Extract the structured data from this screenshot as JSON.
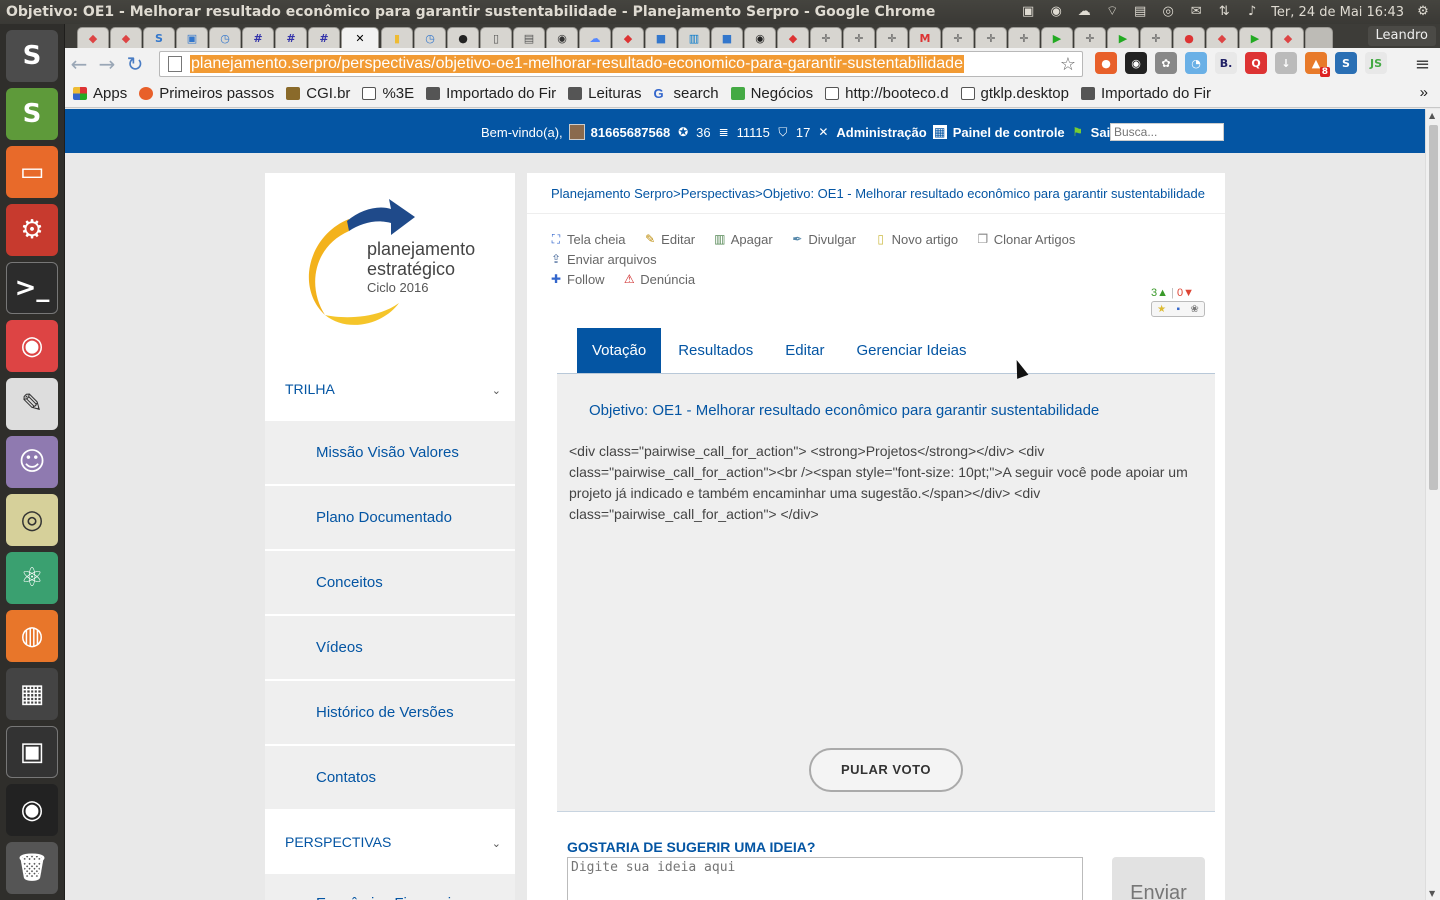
{
  "window": {
    "title": "Objetivo: OE1 - Melhorar resultado econômico para garantir sustentabilidade - Planejamento Serpro - Google Chrome",
    "clock": "Ter, 24 de Mai 16:43"
  },
  "chrome": {
    "profile": "Leandro",
    "url": "planejamento.serpro/perspectivas/objetivo-oe1-melhorar-resultado-economico-para-garantir-sustentabilidade",
    "bookmarks": [
      {
        "label": "Apps",
        "icon": "apps-grid-icon"
      },
      {
        "label": "Primeiros passos",
        "icon": "firefox-icon"
      },
      {
        "label": "CGI.br",
        "icon": "cgi-icon"
      },
      {
        "label": "%3E",
        "icon": "page-icon"
      },
      {
        "label": "Importado do Fir",
        "icon": "folder-icon"
      },
      {
        "label": "Leituras",
        "icon": "folder-icon"
      },
      {
        "label": "search",
        "icon": "google-icon"
      },
      {
        "label": "Negócios",
        "icon": "upwork-icon"
      },
      {
        "label": "http://booteco.d",
        "icon": "page-icon"
      },
      {
        "label": "gtklp.desktop",
        "icon": "page-icon"
      },
      {
        "label": "Importado do Fir",
        "icon": "folder-icon"
      }
    ],
    "bookmarks_more": "»",
    "extension_badge": "8"
  },
  "site": {
    "welcome": "Bem-vindo(a),",
    "user": "81665687568",
    "points": "36",
    "coins": "11115",
    "badges": "17",
    "admin": "Administração",
    "panel": "Painel de controle",
    "logout": "Sair",
    "search_placeholder": "Busca..."
  },
  "logo": {
    "line1": "planejamento",
    "line2": "estratégico",
    "line3": "Ciclo 2016"
  },
  "sidebar": {
    "head1": "TRILHA",
    "items": [
      "Missão Visão Valores",
      "Plano Documentado",
      "Conceitos",
      "Vídeos",
      "Histórico de Versões",
      "Contatos"
    ],
    "head2": "PERSPECTIVAS",
    "sub1": "Econômico Financeira"
  },
  "breadcrumb": {
    "root": "Planejamento Serpro",
    "sep": ">",
    "level1": "Perspectivas",
    "current": "Objetivo: OE1 - Melhorar resultado econômico para garantir sustentabilidade"
  },
  "actions": {
    "fullscreen": "Tela cheia",
    "edit": "Editar",
    "delete": "Apagar",
    "spread": "Divulgar",
    "new_article": "Novo artigo",
    "clone": "Clonar Artigos",
    "upload": "Enviar arquivos",
    "follow": "Follow",
    "report": "Denúncia"
  },
  "votes": {
    "up": "3",
    "down": "0"
  },
  "tabs": [
    "Votação",
    "Resultados",
    "Editar",
    "Gerenciar Ideias"
  ],
  "vote_panel": {
    "title": "Objetivo: OE1 - Melhorar resultado econômico para garantir sustentabilidade",
    "body": "<div class=\"pairwise_call_for_action\"> <strong>Projetos</strong></div> <div class=\"pairwise_call_for_action\"><br /><span style=\"font-size: 10pt;\">A seguir você pode apoiar um projeto já indicado e também encaminhar uma sugestão.</span></div> <div class=\"pairwise_call_for_action\"> </div>",
    "skip": "PULAR VOTO"
  },
  "suggest": {
    "title": "GOSTARIA DE SUGERIR UMA IDEIA?",
    "placeholder": "Digite sua ideia aqui",
    "send": "Enviar"
  },
  "colors": {
    "brand_blue": "#0455a3",
    "url_highlight": "#f29b34",
    "launcher_bg": "#2f2e2b"
  }
}
